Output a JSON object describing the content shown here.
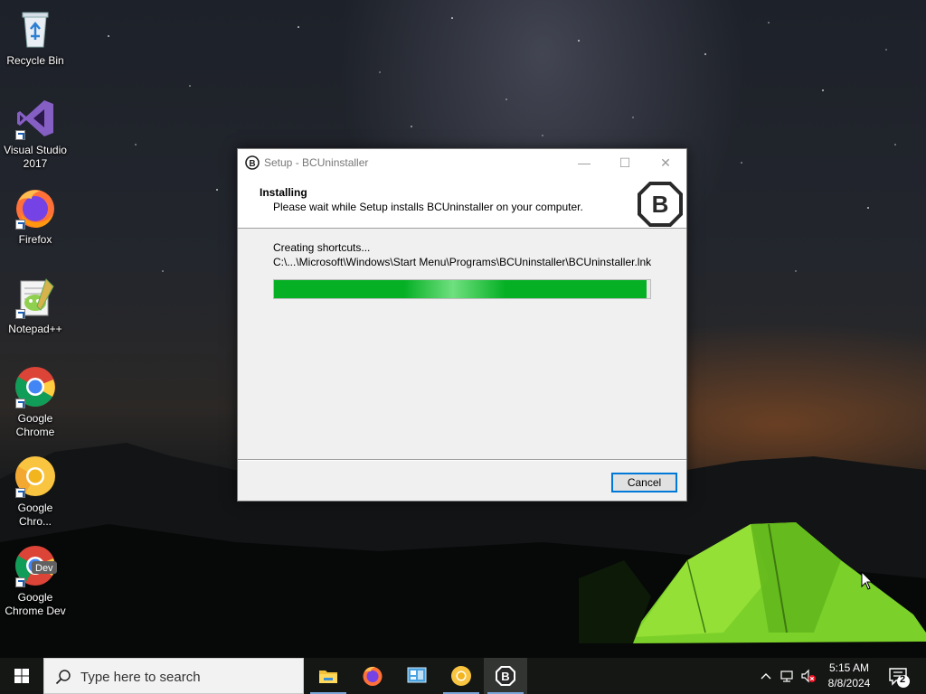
{
  "desktop": {
    "icons": [
      {
        "label": "Recycle Bin",
        "icon": "recycle-bin-icon"
      },
      {
        "label": "Visual Studio 2017",
        "icon": "visual-studio-icon"
      },
      {
        "label": "Firefox",
        "icon": "firefox-icon"
      },
      {
        "label": "Notepad++",
        "icon": "notepadpp-icon"
      },
      {
        "label": "Google Chrome",
        "icon": "chrome-icon"
      },
      {
        "label": "Google Chro...",
        "icon": "chrome-canary-icon"
      },
      {
        "label": "Google Chrome Dev",
        "icon": "chrome-dev-icon",
        "badge": "Dev"
      }
    ]
  },
  "window": {
    "title": "Setup - BCUninstaller",
    "header_title": "Installing",
    "header_subtitle": "Please wait while Setup installs BCUninstaller on your computer.",
    "status": "Creating shortcuts...",
    "path": "C:\\...\\Microsoft\\Windows\\Start Menu\\Programs\\BCUninstaller\\BCUninstaller.lnk",
    "progress_percent": 99,
    "cancel_label": "Cancel",
    "logo_letter": "B"
  },
  "taskbar": {
    "search_placeholder": "Type here to search",
    "apps": [
      "file-explorer-icon",
      "firefox-icon",
      "control-panel-icon",
      "chrome-canary-icon",
      "bcuninstaller-icon"
    ],
    "time": "5:15 AM",
    "date": "8/8/2024",
    "notification_count": "2"
  },
  "colors": {
    "progress": "#06b025",
    "accent": "#0078d7"
  }
}
